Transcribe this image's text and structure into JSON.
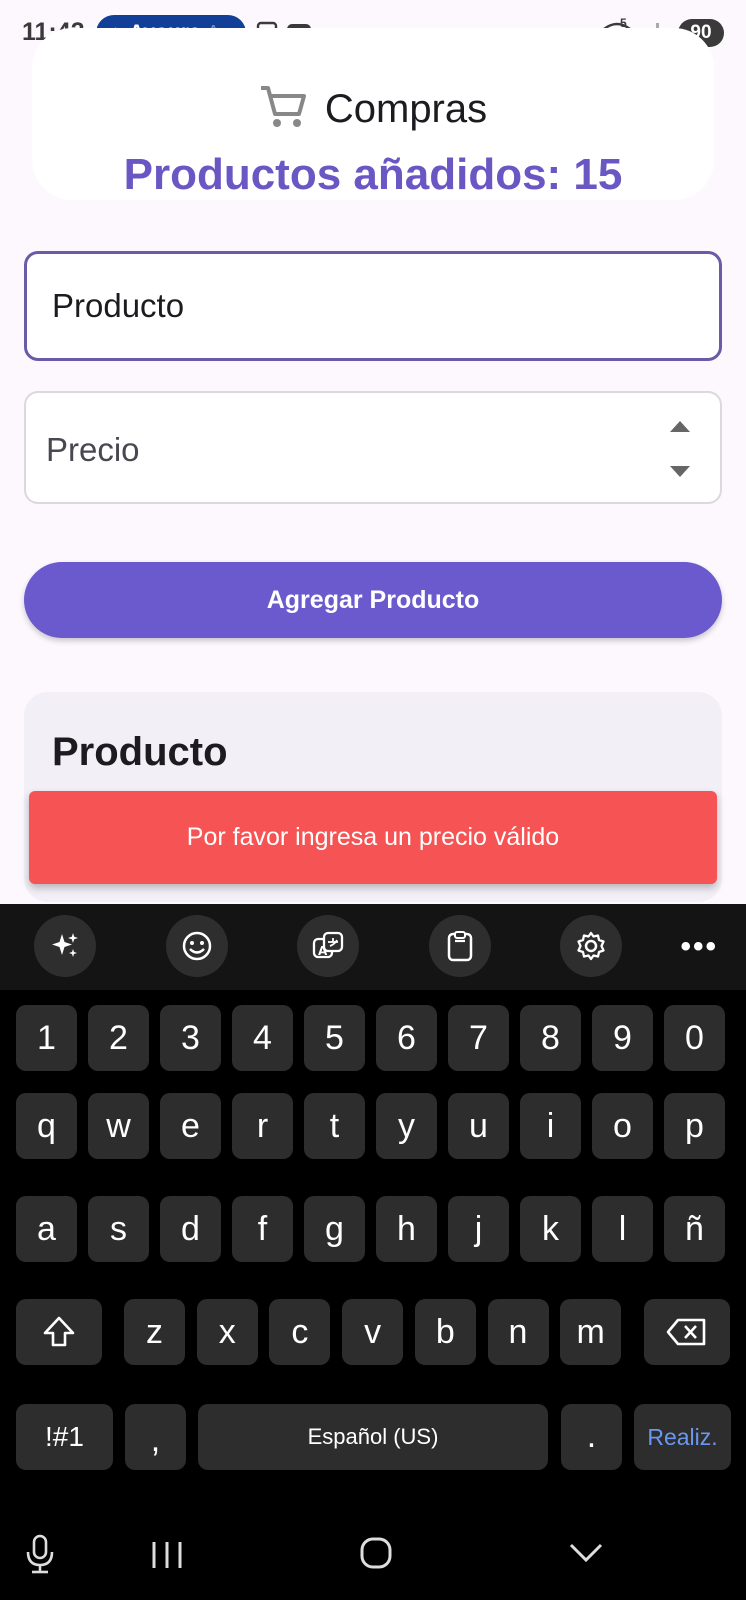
{
  "status_bar": {
    "time": "11:42",
    "media_app": "Avoure",
    "media_extra": "A",
    "battery": "90",
    "wifi_label": "5"
  },
  "header": {
    "title": "Compras",
    "count_text": "Productos añadidos: 15",
    "icon": "shopping-cart-icon"
  },
  "form": {
    "product_value": "Producto",
    "price_placeholder": "Precio",
    "add_button": "Agregar Producto"
  },
  "list": {
    "title": "Producto"
  },
  "snackbar": {
    "message": "Por favor ingresa un precio válido"
  },
  "keyboard": {
    "toolbar": [
      "sparkle-icon",
      "emoji-icon",
      "translate-icon",
      "clipboard-icon",
      "settings-icon",
      "more-icon"
    ],
    "number_row": [
      "1",
      "2",
      "3",
      "4",
      "5",
      "6",
      "7",
      "8",
      "9",
      "0"
    ],
    "row1": [
      "q",
      "w",
      "e",
      "r",
      "t",
      "y",
      "u",
      "i",
      "o",
      "p"
    ],
    "row2": [
      "a",
      "s",
      "d",
      "f",
      "g",
      "h",
      "j",
      "k",
      "l",
      "ñ"
    ],
    "row3": [
      "z",
      "x",
      "c",
      "v",
      "b",
      "n",
      "m"
    ],
    "symbols_key": "!#1",
    "comma_key": ",",
    "space_label": "Español (US)",
    "period_key": ".",
    "action_key": "Realiz."
  },
  "colors": {
    "accent": "#6a5acd",
    "count_text": "#6a57c4",
    "snackbar": "#f65454",
    "action_key_text": "#6a98f0"
  }
}
